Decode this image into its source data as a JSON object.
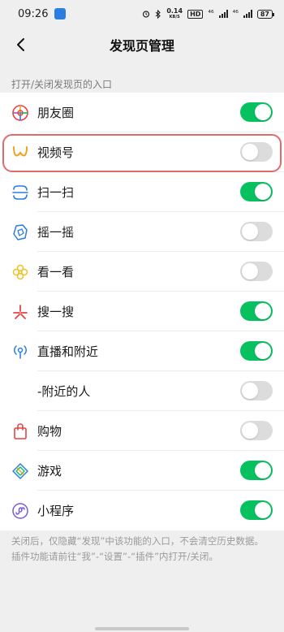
{
  "status_bar": {
    "time": "09:26",
    "net_speed_value": "0.14",
    "net_speed_unit": "KB/S",
    "hd_badge": "HD",
    "signal_1": "⁴⁶",
    "signal_2": "⁴⁶",
    "battery": "87"
  },
  "nav": {
    "title": "发现页管理"
  },
  "section": {
    "label": "打开/关闭发现页的入口"
  },
  "items": [
    {
      "label": "朋友圈",
      "icon": "moments-icon",
      "enabled": true
    },
    {
      "label": "视频号",
      "icon": "channels-icon",
      "enabled": false
    },
    {
      "label": "扫一扫",
      "icon": "scan-icon",
      "enabled": true
    },
    {
      "label": "摇一摇",
      "icon": "shake-icon",
      "enabled": false
    },
    {
      "label": "看一看",
      "icon": "top-stories-icon",
      "enabled": false
    },
    {
      "label": "搜一搜",
      "icon": "search-icon",
      "enabled": true
    },
    {
      "label": "直播和附近",
      "icon": "live-nearby-icon",
      "enabled": true
    },
    {
      "label": "-附近的人",
      "icon": "",
      "enabled": false
    },
    {
      "label": "购物",
      "icon": "shopping-icon",
      "enabled": false
    },
    {
      "label": "游戏",
      "icon": "games-icon",
      "enabled": true
    },
    {
      "label": "小程序",
      "icon": "mini-programs-icon",
      "enabled": true
    }
  ],
  "footer": {
    "note": "关闭后，仅隐藏“发现”中该功能的入口，不会清空历史数据。插件功能请前往“我”-“设置”-“插件”内打开/关闭。"
  },
  "colors": {
    "toggle_on": "#07c160",
    "toggle_off": "#dcdcdc",
    "highlight": "#e06b6f"
  }
}
